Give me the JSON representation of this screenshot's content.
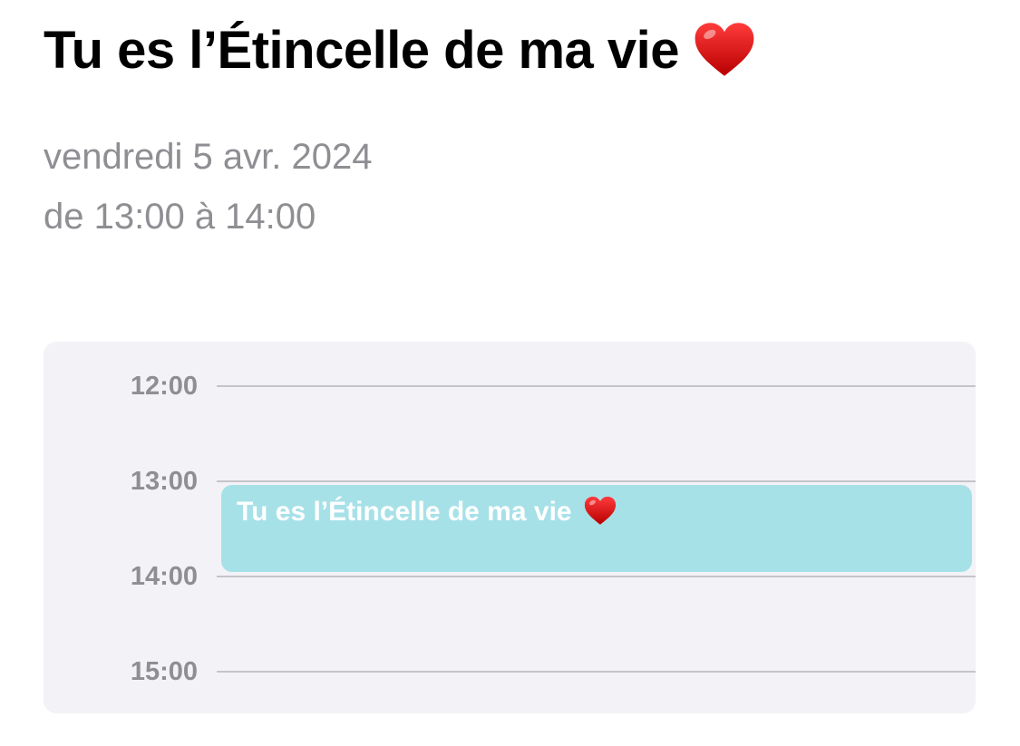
{
  "event": {
    "title": "Tu es l’Étincelle de ma vie",
    "emoji": "red-heart",
    "date": "vendredi 5 avr. 2024",
    "time_range": "de 13:00 à 14:00"
  },
  "timeline": {
    "hours": [
      "12:00",
      "13:00",
      "14:00",
      "15:00"
    ],
    "event_block": {
      "title": "Tu es l’Étincelle de ma vie",
      "start": "13:00",
      "end": "14:00",
      "color": "#a7e1e8"
    }
  },
  "colors": {
    "secondary_text": "#8e8e93",
    "timeline_background": "#f2f2f7",
    "heart": "#d40a0a"
  }
}
